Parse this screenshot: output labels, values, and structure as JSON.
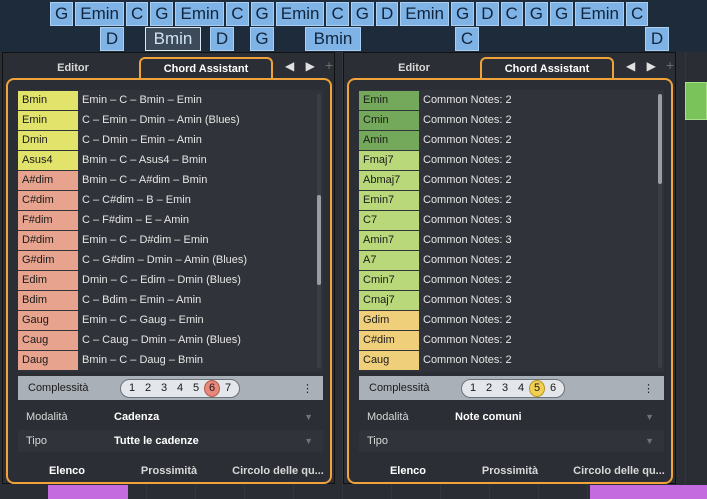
{
  "chord_track": {
    "row1": [
      "G",
      "Emin",
      "C",
      "G",
      "Emin",
      "C",
      "G",
      "Emin",
      "C",
      "G",
      "D",
      "Emin",
      "G",
      "D",
      "C",
      "G",
      "G",
      "Emin",
      "C"
    ],
    "row2": [
      "D",
      "Bmin",
      "D",
      "G",
      "Bmin",
      "C",
      "D"
    ]
  },
  "left_panel": {
    "tab_editor": "Editor",
    "tab_assistant": "Chord Assistant",
    "nav_arrows": "◀ ▶",
    "plus": "+",
    "rows": [
      {
        "chord": "Bmin",
        "text": "Emin – C – Bmin – Emin",
        "color": "#e2e36a"
      },
      {
        "chord": "Emin",
        "text": "C – Emin – Dmin – Amin (Blues)",
        "color": "#e2e36a"
      },
      {
        "chord": "Dmin",
        "text": "C – Dmin – Emin – Amin",
        "color": "#e2e36a"
      },
      {
        "chord": "Asus4",
        "text": "Bmin – C – Asus4 – Bmin",
        "color": "#e2e36a"
      },
      {
        "chord": "A#dim",
        "text": "Bmin – C – A#dim – Bmin",
        "color": "#e8a38f"
      },
      {
        "chord": "C#dim",
        "text": "C – C#dim – B – Emin",
        "color": "#e8a38f"
      },
      {
        "chord": "F#dim",
        "text": "C – F#dim – E – Amin",
        "color": "#e8a38f"
      },
      {
        "chord": "D#dim",
        "text": "Emin – C – D#dim – Emin",
        "color": "#e8a38f"
      },
      {
        "chord": "G#dim",
        "text": "C – G#dim – Dmin – Amin (Blues)",
        "color": "#e8a38f"
      },
      {
        "chord": "Edim",
        "text": "Dmin – C – Edim – Dmin (Blues)",
        "color": "#e8a38f"
      },
      {
        "chord": "Bdim",
        "text": "C – Bdim – Emin – Amin",
        "color": "#e8a38f"
      },
      {
        "chord": "Gaug",
        "text": "Emin – C – Gaug – Emin",
        "color": "#e8a38f"
      },
      {
        "chord": "Caug",
        "text": "C – Caug – Dmin – Amin (Blues)",
        "color": "#e8a38f"
      },
      {
        "chord": "Daug",
        "text": "Bmin – C – Daug – Bmin",
        "color": "#e8a38f"
      }
    ],
    "complexity_label": "Complessità",
    "complexity_levels": [
      "1",
      "2",
      "3",
      "4",
      "5",
      "6",
      "7"
    ],
    "complexity_selected": 6,
    "sort_icon": "⋮",
    "mode_label": "Modalità",
    "mode_value": "Cadenza",
    "type_label": "Tipo",
    "type_value": "Tutte le cadenze",
    "bottom_tabs": [
      "Elenco",
      "Prossimità",
      "Circolo delle qu..."
    ],
    "scroll_position": 0.55
  },
  "right_panel": {
    "tab_editor": "Editor",
    "tab_assistant": "Chord Assistant",
    "nav_arrows": "◀ ▶",
    "plus": "+",
    "rows": [
      {
        "chord": "Emin",
        "text": "Common Notes: 2",
        "color": "#74a85a"
      },
      {
        "chord": "Cmin",
        "text": "Common Notes: 2",
        "color": "#74a85a"
      },
      {
        "chord": "Amin",
        "text": "Common Notes: 2",
        "color": "#74a85a"
      },
      {
        "chord": "Fmaj7",
        "text": "Common Notes: 2",
        "color": "#b8d87a"
      },
      {
        "chord": "Abmaj7",
        "text": "Common Notes: 2",
        "color": "#b8d87a"
      },
      {
        "chord": "Emin7",
        "text": "Common Notes: 2",
        "color": "#b8d87a"
      },
      {
        "chord": "C7",
        "text": "Common Notes: 3",
        "color": "#b8d87a"
      },
      {
        "chord": "Amin7",
        "text": "Common Notes: 3",
        "color": "#b8d87a"
      },
      {
        "chord": "A7",
        "text": "Common Notes: 2",
        "color": "#b8d87a"
      },
      {
        "chord": "Cmin7",
        "text": "Common Notes: 2",
        "color": "#b8d87a"
      },
      {
        "chord": "Cmaj7",
        "text": "Common Notes: 3",
        "color": "#b8d87a"
      },
      {
        "chord": "Gdim",
        "text": "Common Notes: 2",
        "color": "#efcf7a"
      },
      {
        "chord": "C#dim",
        "text": "Common Notes: 2",
        "color": "#efcf7a"
      },
      {
        "chord": "Caug",
        "text": "Common Notes: 2",
        "color": "#efcf7a"
      }
    ],
    "complexity_label": "Complessità",
    "complexity_levels": [
      "1",
      "2",
      "3",
      "4",
      "5",
      "6"
    ],
    "complexity_selected": 5,
    "sort_icon": "⋮",
    "mode_label": "Modalità",
    "mode_value": "Note comuni",
    "type_label": "Tipo",
    "type_value": "",
    "bottom_tabs": [
      "Elenco",
      "Prossimità",
      "Circolo delle qu..."
    ],
    "scroll_position": 0.0
  }
}
